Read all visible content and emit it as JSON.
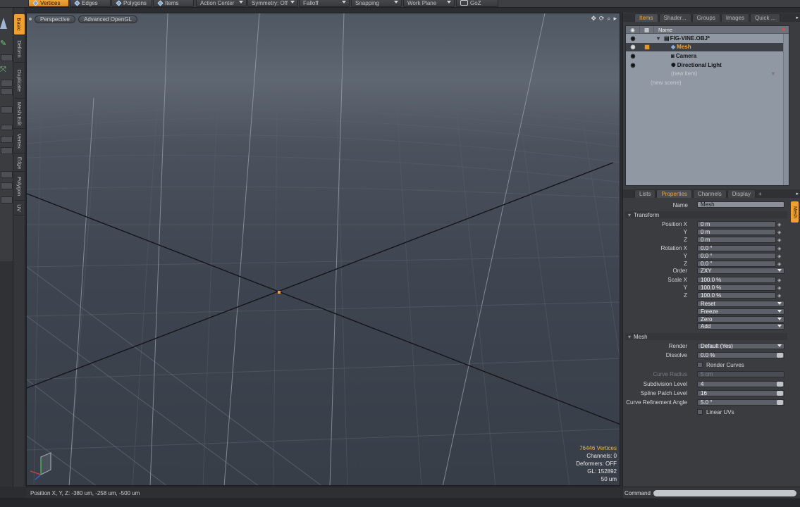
{
  "toolbar": {
    "modes": [
      {
        "label": "Vertices",
        "active": true
      },
      {
        "label": "Edges",
        "active": false
      },
      {
        "label": "Polygons",
        "active": false
      },
      {
        "label": "Items",
        "active": false
      }
    ],
    "dropdowns": [
      "Action Center",
      "Symmetry: Off",
      "Falloff",
      "Snapping",
      "Work Plane"
    ],
    "goz_label": "GoZ"
  },
  "side_tabs": [
    "Basic",
    "Deform",
    "Duplicate",
    "Mesh Edit",
    "Vertex",
    "Edge",
    "Polygon",
    "UV"
  ],
  "viewport": {
    "view_label": "Perspective",
    "render_label": "Advanced OpenGL",
    "stats": {
      "vertices": "76446 Vertices",
      "channels": "Channels: 0",
      "deformers": "Deformers: OFF",
      "gl": "GL: 152892",
      "scale": "50 um"
    }
  },
  "status": {
    "position": "Position X, Y, Z:  -380 um, -258 um, -500 um"
  },
  "items_panel": {
    "tabs": [
      "Items",
      "Shader...",
      "Groups",
      "Images",
      "Quick ..."
    ],
    "column_name": "Name",
    "rows": [
      {
        "label": "FIG-VINE.OBJ*",
        "selected": false
      },
      {
        "label": "Mesh",
        "selected": true
      },
      {
        "label": "Camera",
        "selected": false
      },
      {
        "label": "Directional Light",
        "selected": false
      }
    ],
    "new_item": "(new item)",
    "new_scene": "(new scene)"
  },
  "props_panel": {
    "tabs": [
      "Lists",
      "Properties",
      "Channels",
      "Display"
    ],
    "side_tab": "Mesh",
    "name_label": "Name",
    "name_value": "Mesh",
    "transform_header": "Transform",
    "position_label": "Position X",
    "rotation_label": "Rotation X",
    "scale_label": "Scale X",
    "y_label": "Y",
    "z_label": "Z",
    "order_label": "Order",
    "position": [
      "0 m",
      "0 m",
      "0 m"
    ],
    "rotation": [
      "0.0 °",
      "0.0 °",
      "0.0 °"
    ],
    "order_value": "ZXY",
    "scale": [
      "100.0 %",
      "100.0 %",
      "100.0 %"
    ],
    "actions": [
      "Reset",
      "Freeze",
      "Zero",
      "Add"
    ],
    "mesh_header": "Mesh",
    "render_label": "Render",
    "render_value": "Default (Yes)",
    "dissolve_label": "Dissolve",
    "dissolve_value": "0.0 %",
    "render_curves_label": "Render Curves",
    "curve_radius_label": "Curve Radius",
    "curve_radius_value": "5 cm",
    "subdiv_label": "Subdivision Level",
    "subdiv_value": "4",
    "spline_label": "Spline Patch Level",
    "spline_value": "16",
    "curve_refine_label": "Curve Refinement Angle",
    "curve_refine_value": "5.0 °",
    "linear_uvs_label": "Linear UVs"
  },
  "command": {
    "label": "Command"
  }
}
